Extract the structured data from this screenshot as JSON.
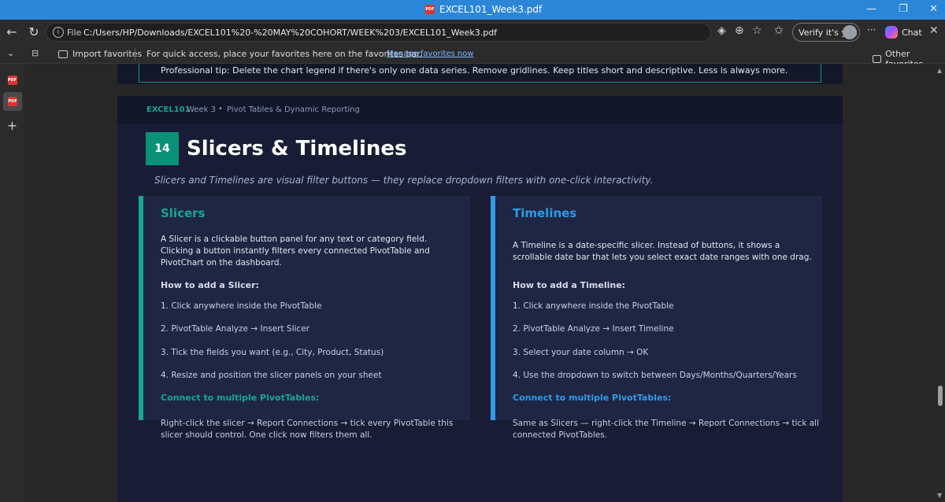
{
  "window": {
    "title": "EXCEL101_Week3.pdf",
    "minimize_icon": "—",
    "restore_icon": "❐",
    "close_icon": "✕"
  },
  "address_bar": {
    "scheme_label": "File",
    "url": "C:/Users/HP/Downloads/EXCEL101%20-%20MAY%20COHORT/WEEK%203/EXCEL101_Week3.pdf",
    "verify_label": "Verify it's you",
    "chat_label": "Chat",
    "more_label": "···"
  },
  "favorites_bar": {
    "import_label": "Import favorites",
    "message": "For quick access, place your favorites here on the favorites bar.",
    "manage_link": "Manage favorites now",
    "other_label": "Other favorites"
  },
  "sidebar": {
    "pdf_badge": "PDF",
    "add_label": "+"
  },
  "previous_page": {
    "tip": "Professional tip: Delete the chart legend if there's only one data series. Remove gridlines. Keep titles short and descriptive. Less is always more."
  },
  "page": {
    "brand": "EXCEL101",
    "week": "Week 3",
    "separator": "•",
    "topic": "Pivot Tables & Dynamic Reporting",
    "section_number": "14",
    "title": "Slicers & Timelines",
    "subtitle": "Slicers and Timelines are visual filter buttons — they replace dropdown filters with one-click interactivity.",
    "slicers": {
      "heading": "Slicers",
      "description": "A Slicer is a clickable button panel for any text or category field. Clicking a button instantly filters every connected PivotTable and PivotChart on the dashboard.",
      "howto": "How to add a Slicer:",
      "steps": [
        "1.  Click anywhere inside the PivotTable",
        "2.  PivotTable Analyze → Insert Slicer",
        "3.  Tick the fields you want (e.g., City, Product, Status)",
        "4.  Resize and position the slicer panels on your sheet"
      ],
      "connect_heading": "Connect to multiple PivotTables:",
      "connect_text": "Right-click the slicer → Report Connections → tick every PivotTable this slicer should control. One click now filters them all."
    },
    "timelines": {
      "heading": "Timelines",
      "description": "A Timeline is a date-specific slicer. Instead of buttons, it shows a scrollable date bar that lets you select exact date ranges with one drag.",
      "howto": "How to add a Timeline:",
      "steps": [
        "1.  Click anywhere inside the PivotTable",
        "2.  PivotTable Analyze → Insert Timeline",
        "3.  Select your date column → OK",
        "4.  Use the dropdown to switch between Days/Months/Quarters/Years"
      ],
      "connect_heading": "Connect to multiple PivotTables:",
      "connect_text": "Same as Slicers — right-click the Timeline → Report Connections → tick all connected PivotTables."
    }
  },
  "colors": {
    "accent_teal": "#1aa591",
    "accent_blue": "#2f9be6",
    "card_bg": "#1f2644",
    "page_bg": "#181d35"
  }
}
